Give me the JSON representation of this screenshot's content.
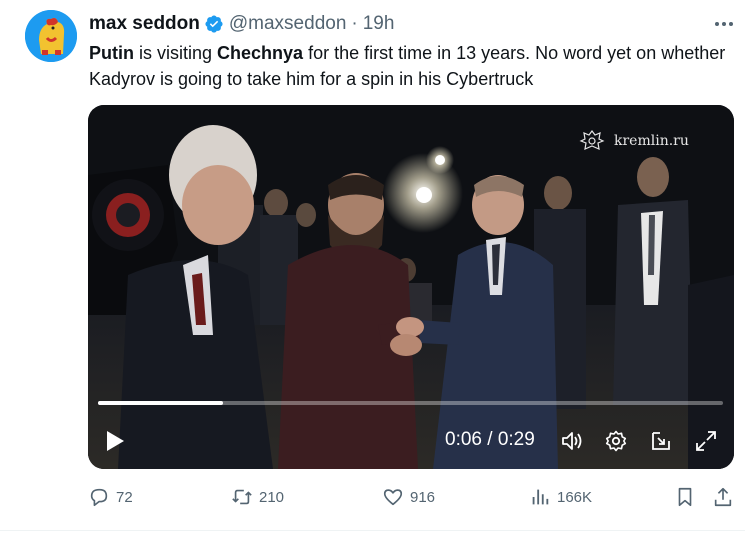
{
  "author": {
    "name": "max seddon",
    "handle": "@maxseddon",
    "separator": "·",
    "time": "19h"
  },
  "tweet": {
    "text_parts": [
      "Putin",
      " is visiting ",
      "Chechnya",
      " for the first time in 13 years. No word yet on whether Kadyrov is going to take him for a spin in his Cybertruck"
    ]
  },
  "video": {
    "watermark": "kremlin.ru",
    "current_time": "0:06",
    "time_separator": " / ",
    "duration": "0:29",
    "progress_fraction": 0.2
  },
  "actions": {
    "replies": "72",
    "reposts": "210",
    "likes": "916",
    "views": "166K"
  },
  "colors": {
    "accent": "#1d9bf0",
    "secondary_text": "#536471"
  }
}
